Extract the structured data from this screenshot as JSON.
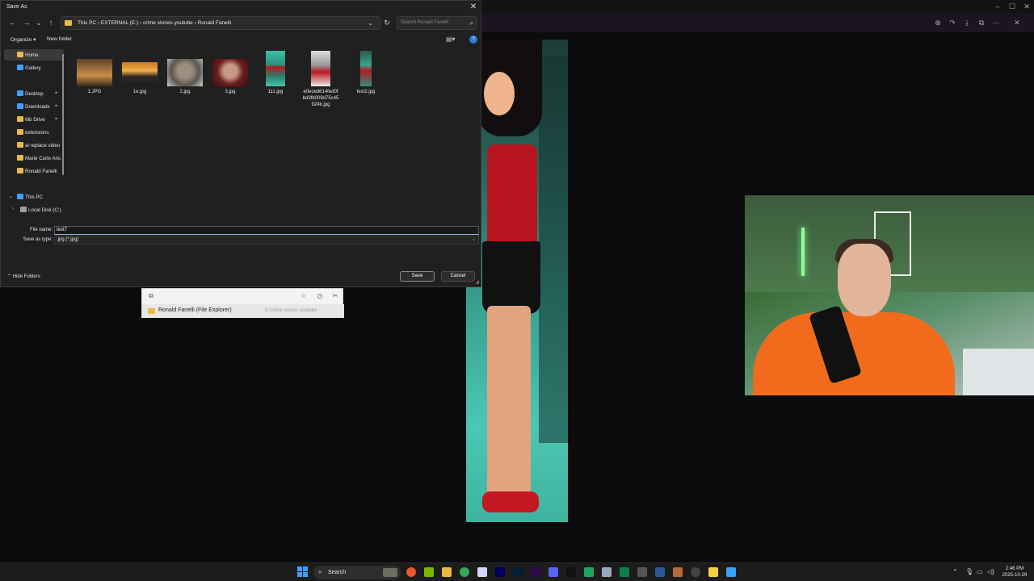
{
  "dialog": {
    "title": "Save As",
    "close_glyph": "✕",
    "nav": {
      "back": "←",
      "forward": "→",
      "recent": "⌄",
      "up": "↑",
      "refresh": "↻"
    },
    "breadcrumb": {
      "items": [
        "This PC",
        "EXTERNAL (E:)",
        "crime stories youtube",
        "Ronald Fanelli"
      ],
      "display": "This PC  ›  EXTERNAL (E:)  ›  crime stories youtube  ›  Ronald Fanelli"
    },
    "search": {
      "placeholder": "Search Ronald Fanelli"
    },
    "commands": {
      "organize": "Organize ▾",
      "new_folder": "New folder",
      "help": "?"
    },
    "nav_pane": {
      "items": [
        {
          "label": "Home",
          "icon": "home-icon",
          "color": "#e9b949",
          "selected": true
        },
        {
          "label": "Gallery",
          "icon": "gallery-icon",
          "color": "#3ba0ff"
        },
        {
          "label": "Desktop",
          "icon": "desktop-icon",
          "color": "#3ba0ff",
          "pinned": true
        },
        {
          "label": "Downloads",
          "icon": "downloads-icon",
          "color": "#3ba0ff",
          "pinned": true
        },
        {
          "label": "6tb Drive",
          "icon": "folder-icon",
          "color": "#e9b949",
          "pinned": true
        },
        {
          "label": "extensions",
          "icon": "folder-icon",
          "color": "#e9b949"
        },
        {
          "label": "ai replace video",
          "icon": "folder-icon",
          "color": "#e9b949"
        },
        {
          "label": "Marie Curie Ans",
          "icon": "folder-icon",
          "color": "#e9b949"
        },
        {
          "label": "Ronald Fanelli",
          "icon": "folder-icon",
          "color": "#e9b949"
        },
        {
          "label": "This PC",
          "icon": "pc-icon",
          "color": "#3ba0ff",
          "expanded": true
        },
        {
          "label": "Local Disk (C:)",
          "icon": "disk-icon",
          "color": "#9aa0a6"
        }
      ]
    },
    "files": [
      {
        "name": "1.JPG"
      },
      {
        "name": "1e.jpg"
      },
      {
        "name": "2.jpg"
      },
      {
        "name": "3.jpg"
      },
      {
        "name": "111.jpg"
      },
      {
        "name": "e0eced614fed0f bd3fb009d75c45 924b.jpg"
      },
      {
        "name": "test2.jpg"
      }
    ],
    "file_name_label": "File name:",
    "file_name_value": "test7",
    "save_type_label": "Save as type:",
    "save_type_value": ".jpg (*.jpg)",
    "hide_folders": "Hide Folders",
    "save_button": "Save",
    "cancel_button": "Cancel"
  },
  "popup": {
    "icons": [
      "clipboard-icon",
      "star-icon",
      "history-icon",
      "tools-icon"
    ],
    "suggestion": "Ronald Fanelli (File Explorer)",
    "suggestion_path": "E:\\crime stories youtube"
  },
  "taskbar": {
    "search_label": "Search",
    "clock_time": "2:46 PM",
    "clock_date": "2025-10-29"
  }
}
